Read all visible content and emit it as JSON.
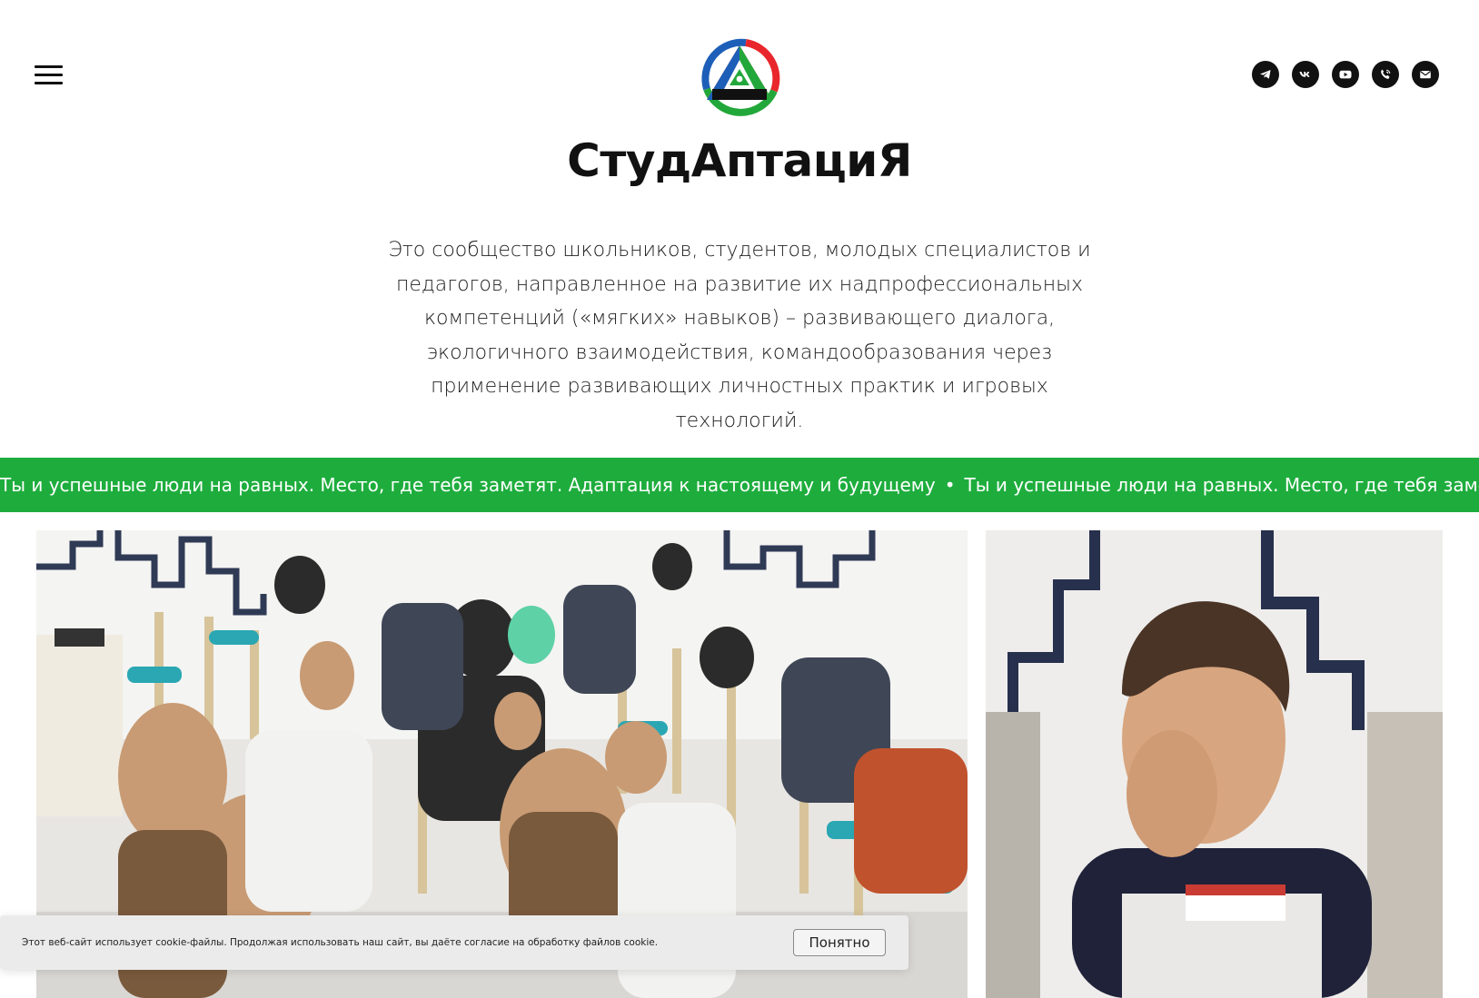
{
  "header": {
    "menu_icon": "hamburger-menu-icon",
    "brand_name": "СтудАптациЯ",
    "socials": [
      {
        "name": "telegram",
        "icon": "telegram-icon"
      },
      {
        "name": "vk",
        "icon": "vk-icon"
      },
      {
        "name": "youtube",
        "icon": "youtube-icon"
      },
      {
        "name": "phone",
        "icon": "phone-icon"
      },
      {
        "name": "email",
        "icon": "email-icon"
      }
    ]
  },
  "intro": {
    "text": "Это сообщество школьников, студентов, молодых специалистов и педагогов, направленное на развитие их надпрофессиональных компетенций («мягких» навыков) – развивающего диалога, экологичного взаимодействия, командообразования через применение развивающих личностных практик и игровых технологий."
  },
  "marquee": {
    "text": "Ты и успешные люди на равных. Место, где тебя заметят. Адаптация к настоящему и будущему",
    "separator": "•"
  },
  "gallery": {
    "photos": [
      "group-session-photo",
      "student-portrait-photo"
    ]
  },
  "cookie_banner": {
    "text": "Этот веб-сайт использует cookie-файлы. Продолжая использовать наш сайт, вы даёте согласие на обработку файлов cookie.",
    "button_label": "Понятно"
  },
  "colors": {
    "accent_green": "#1ead3d",
    "logo_red": "#e8262b",
    "logo_blue": "#1d5fb8",
    "logo_green": "#22a83a",
    "text": "#111111"
  }
}
